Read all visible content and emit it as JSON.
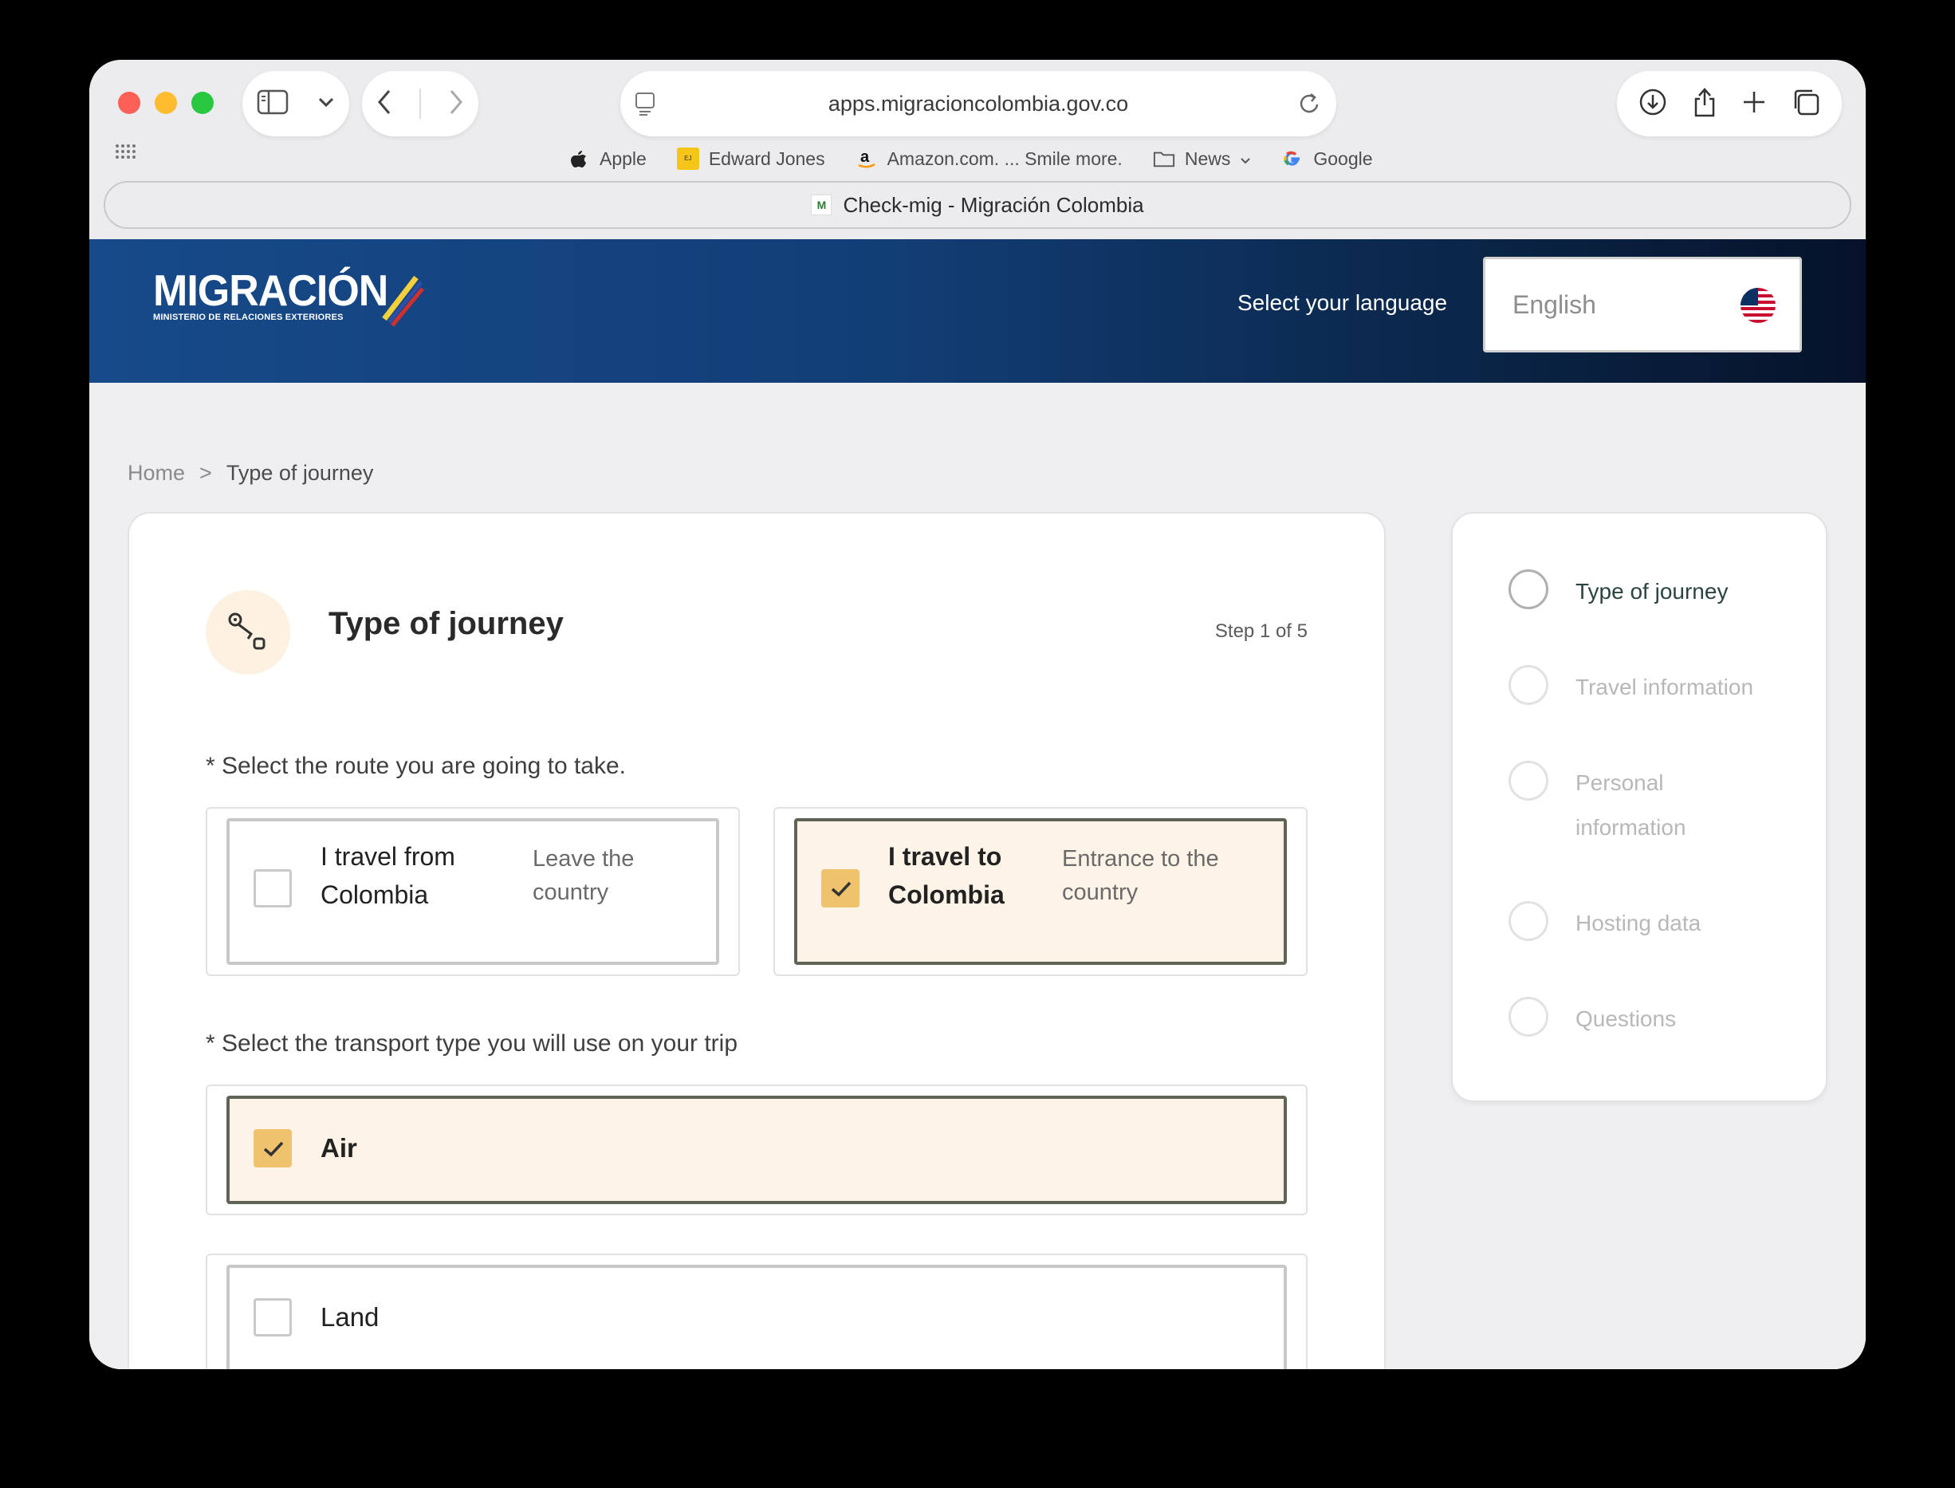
{
  "browser": {
    "url": "apps.migracioncolombia.gov.co",
    "tab_title": "Check-mig - Migración Colombia",
    "bookmarks": [
      {
        "label": "Apple",
        "icon": "apple-icon"
      },
      {
        "label": "Edward Jones",
        "icon": "edward-jones-icon"
      },
      {
        "label": "Amazon.com. ... Smile more.",
        "icon": "amazon-icon"
      },
      {
        "label": "News",
        "icon": "folder-icon"
      },
      {
        "label": "Google",
        "icon": "google-icon"
      }
    ]
  },
  "header": {
    "logo_main": "MIGRACIÓN",
    "logo_sub": "MINISTERIO DE RELACIONES EXTERIORES",
    "language_label": "Select your language",
    "language_value": "English",
    "language_flag": "us-flag-icon"
  },
  "breadcrumb": {
    "home": "Home",
    "separator": ">",
    "current": "Type of journey"
  },
  "form": {
    "title": "Type of journey",
    "step": "Step 1 of 5",
    "route_question": "* Select the route you are going to take.",
    "routes": [
      {
        "title_line1": "I travel from",
        "title_line2": "Colombia",
        "desc_line1": "Leave the",
        "desc_line2": "country",
        "checked": false
      },
      {
        "title_line1": "I travel to",
        "title_line2": "Colombia",
        "desc_line1": "Entrance to the",
        "desc_line2": "country",
        "checked": true
      }
    ],
    "transport_question": "* Select the transport type you will use on your trip",
    "transports": [
      {
        "label": "Air",
        "checked": true
      },
      {
        "label": "Land",
        "checked": false
      }
    ]
  },
  "steps": [
    {
      "label": "Type of journey",
      "active": true
    },
    {
      "label": "Travel information",
      "active": false
    },
    {
      "label": "Personal information",
      "active": false
    },
    {
      "label": "Hosting data",
      "active": false
    },
    {
      "label": "Questions",
      "active": false
    }
  ],
  "colors": {
    "header_blue": "#174a8a",
    "selected_bg": "#fdf3e6",
    "checkbox_checked": "#efc26e",
    "selected_border": "#5f6457"
  }
}
